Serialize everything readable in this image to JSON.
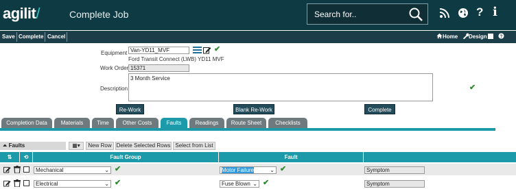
{
  "header": {
    "logo": "agilit",
    "logo_mark": "/",
    "title": "Complete Job",
    "search_placeholder": "Search for.."
  },
  "toolbar": {
    "save": "Save",
    "complete": "Complete",
    "cancel": "Cancel",
    "home": "Home",
    "design": "Design",
    "help": "Help"
  },
  "form": {
    "equipment_label": "Equipment",
    "equipment_value": "Van-YD11_MVF",
    "equipment_desc": "Ford Transit Connect (LWB) YD11 MVF",
    "work_order_label": "Work Order",
    "work_order_value": "15371",
    "description_label": "Description",
    "description_value": "3 Month Service"
  },
  "actions": {
    "rework": "Re-Work",
    "blank_rework": "Blank Re-Work",
    "complete": "Complete"
  },
  "tabs": [
    "Completion Data",
    "Materials",
    "Time",
    "Other Costs",
    "Faults",
    "Readings",
    "Route Sheet",
    "Checklists"
  ],
  "active_tab": "Faults",
  "faults_bar": {
    "title": "Faults",
    "new_row": "New Row",
    "delete_selected": "Delete Selected Rows",
    "select_from_list": "Select from List"
  },
  "grid": {
    "columns": [
      "Fault Group",
      "Fault"
    ],
    "rows": [
      {
        "fault_group": "Mechanical",
        "fault": "Motor Failure",
        "symptom": "Symptom"
      },
      {
        "fault_group": "Electrical",
        "fault": "Fuse Blown",
        "symptom": "Symptom"
      }
    ]
  },
  "colors": {
    "header_bg": "#0e3a44",
    "toolbar_bg": "#1c3e48",
    "accent": "#1d9aa9",
    "tab_inactive": "#6e7a7e",
    "check_green": "#2d8a2d"
  }
}
